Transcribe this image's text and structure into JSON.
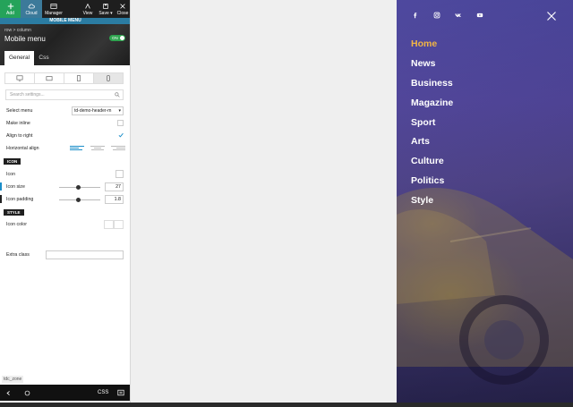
{
  "toolbar": {
    "add": "Add",
    "cloud": "Cloud",
    "manager": "Manager",
    "view": "View",
    "save": "Save ▾",
    "close": "Close"
  },
  "panel_header": "MOBILE MENU",
  "breadcrumb": "row > column",
  "element_title": "Mobile menu",
  "toggle_label": "ON",
  "tabs": {
    "general": "General",
    "css": "Css"
  },
  "search_placeholder": "Search settings...",
  "settings": {
    "select_menu_label": "Select menu",
    "select_menu_value": "td-demo-header-m",
    "make_inline": "Make inline",
    "align_right": "Align to right",
    "horizontal_align": "Horizontal align",
    "section_icon": "ICON",
    "icon_label": "Icon",
    "icon_size_label": "Icon size",
    "icon_size_value": "27",
    "icon_padding_label": "Icon padding",
    "icon_padding_value": "1.8",
    "section_style": "STYLE",
    "icon_color": "Icon color",
    "extra_class": "Extra class"
  },
  "zone_tag": "tdc_zone",
  "bottom": {
    "css": "CSS"
  },
  "preview": {
    "menu_items": [
      "Home",
      "News",
      "Business",
      "Magazine",
      "Sport",
      "Arts",
      "Culture",
      "Politics",
      "Style"
    ],
    "active_index": 0,
    "social_icons": [
      "facebook-icon",
      "instagram-icon",
      "vk-icon",
      "youtube-icon"
    ]
  },
  "colors": {
    "accent_active": "#f2b544",
    "add_button": "#25a35a",
    "panel_header_bg": "#2b7ca2",
    "toggle_on": "#2ea44f",
    "preview_bg": "#4a3f8e"
  }
}
